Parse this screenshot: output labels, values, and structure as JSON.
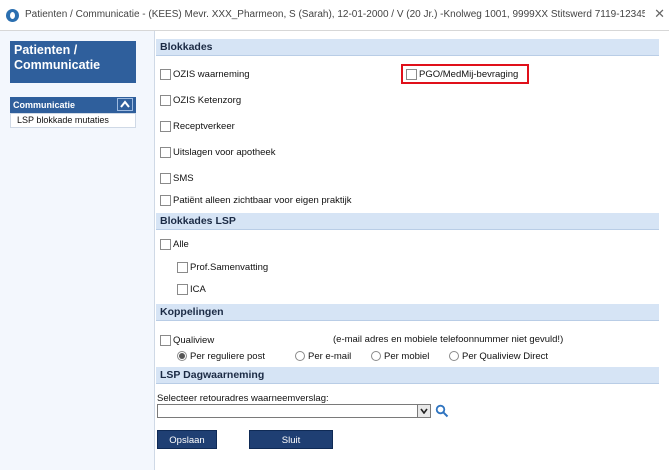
{
  "window": {
    "title": "Patienten / Communicatie - (KEES) Mevr. XXX_Pharmeon, S (Sarah), 12-01-2000 / V (20 Jr.) -Knolweg 1001, 9999XX Stitswerd 7119-12345...",
    "close": "✕"
  },
  "sidebar": {
    "header_line1": "Patienten /",
    "header_line2": "Communicatie",
    "section_label": "Communicatie",
    "items": [
      "LSP blokkade mutaties"
    ]
  },
  "blokkades": {
    "title": "Blokkades",
    "left_items": [
      "OZIS waarneming",
      "OZIS Ketenzorg",
      "Receptverkeer",
      "Uitslagen voor apotheek",
      "SMS",
      "Patiënt alleen zichtbaar voor eigen praktijk"
    ],
    "right_item": "PGO/MedMij-bevraging"
  },
  "blokkades_lsp": {
    "title": "Blokkades LSP",
    "all": "Alle",
    "items": [
      "Prof.Samenvatting",
      "ICA"
    ]
  },
  "koppelingen": {
    "title": "Koppelingen",
    "qualiview": "Qualiview",
    "note": "(e-mail adres en mobiele telefoonnummer niet gevuld!)",
    "radios": [
      "Per reguliere post",
      "Per e-mail",
      "Per mobiel",
      "Per Qualiview Direct"
    ],
    "selected": "Per reguliere post"
  },
  "dagwaarneming": {
    "title": "LSP Dagwaarneming",
    "field_label": "Selecteer retouradres waarneemverslag:",
    "field_value": ""
  },
  "buttons": {
    "save": "Opslaan",
    "close": "Sluit"
  },
  "colors": {
    "accent": "#2f5f9c",
    "section_bg": "#d6e4f5",
    "highlight": "#e0101a",
    "button": "#1f3f73"
  }
}
